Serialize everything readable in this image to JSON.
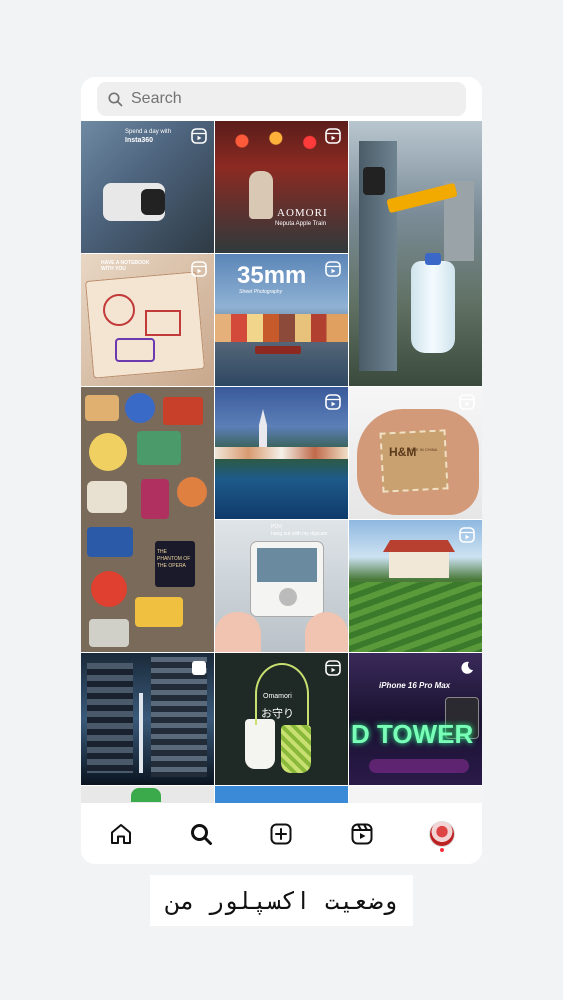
{
  "search": {
    "placeholder": "Search"
  },
  "tiles": [
    {
      "text1": "Spend a day with",
      "text2": "Insta360"
    },
    {
      "text1": "AOMORI",
      "text2": "Neputa Apple Train"
    },
    {},
    {
      "text1": "HAVE A NOTEBOOK",
      "text2": "WITH YOU"
    },
    {
      "text1": "35mm",
      "text2": "Street Photography"
    },
    {},
    {
      "text1": "THE PHANTOM OF THE OPERA"
    },
    {},
    {
      "text1": "H&M",
      "text2": "MADE IN CHINA"
    },
    {
      "text1": "POV:",
      "text2": "hang out with my digicam"
    },
    {},
    {},
    {
      "text1": "Omamori",
      "text2": "お守り"
    },
    {
      "text1": "iPhone 16 Pro Max",
      "text2": "D TOWER"
    }
  ],
  "nav": [
    "home",
    "search",
    "create",
    "reels",
    "profile"
  ],
  "caption": "وضعیت اکسپلور من",
  "colors": {
    "accent": "#ff3040",
    "search_bg": "#efefef",
    "page_bg": "#f2f3f5"
  }
}
